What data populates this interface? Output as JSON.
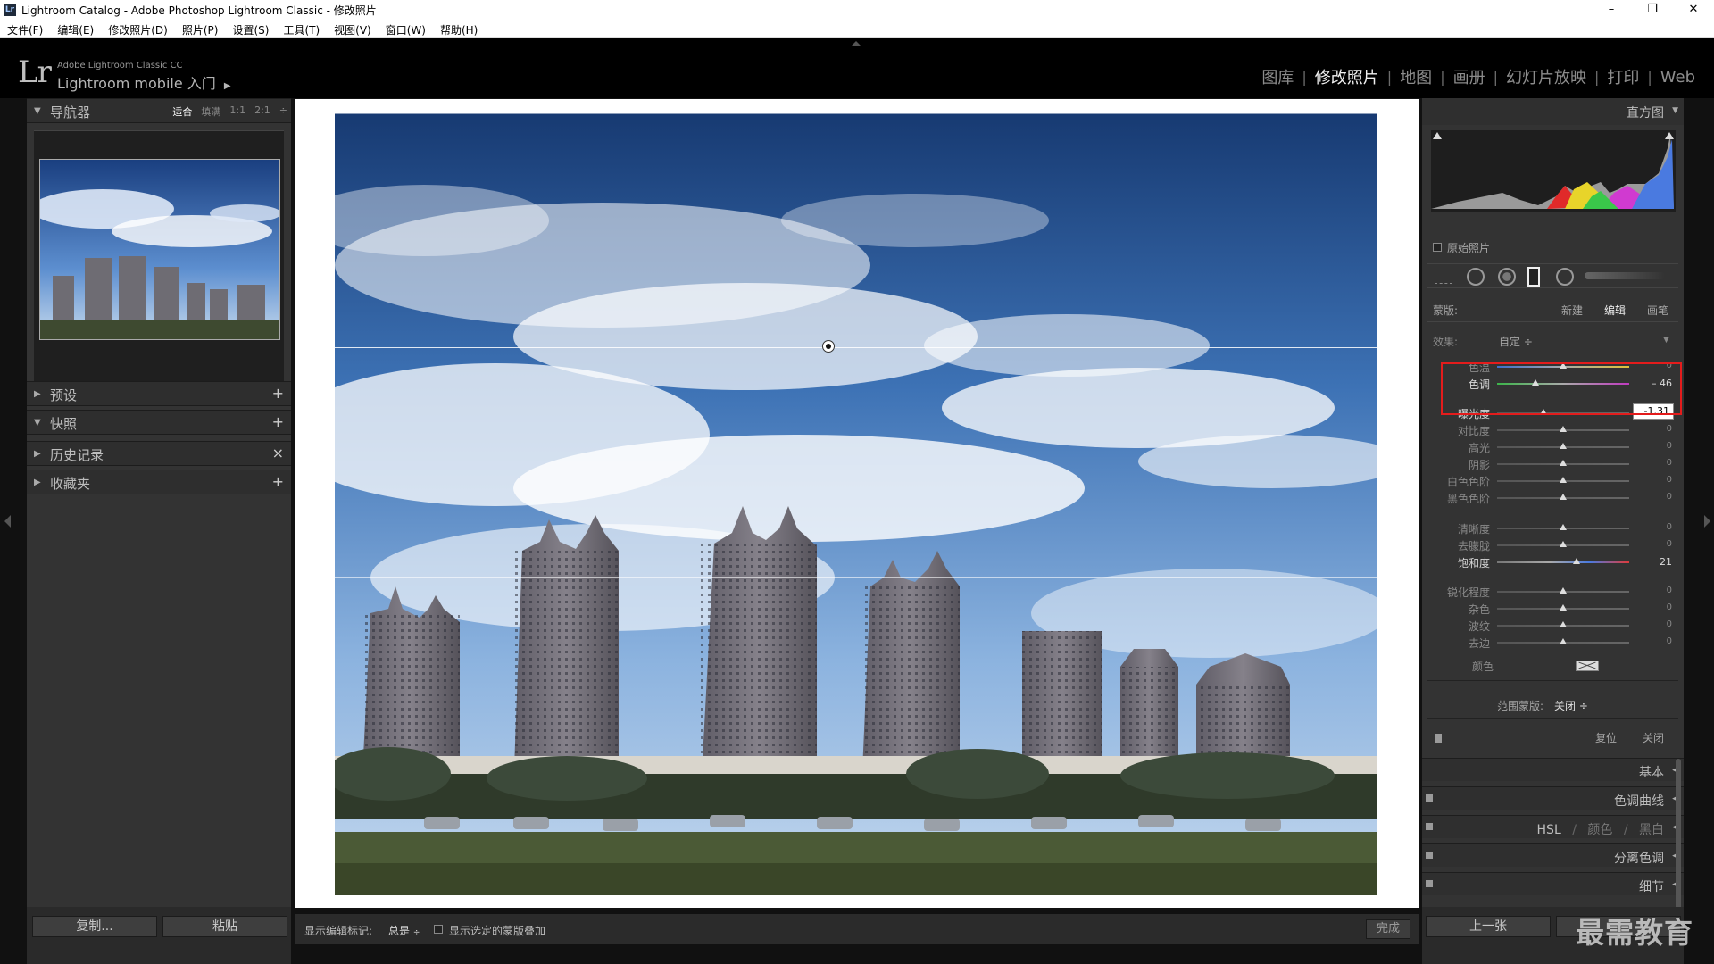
{
  "window": {
    "app_icon": "Lr",
    "title": "Lightroom Catalog - Adobe Photoshop Lightroom Classic - 修改照片",
    "minimize": "–",
    "maximize": "❐",
    "close": "✕"
  },
  "menu": [
    "文件(F)",
    "编辑(E)",
    "修改照片(D)",
    "照片(P)",
    "设置(S)",
    "工具(T)",
    "视图(V)",
    "窗口(W)",
    "帮助(H)"
  ],
  "identity": {
    "logo": "Lr",
    "product": "Adobe Lightroom Classic CC",
    "mobile": "Lightroom mobile 入门",
    "mobile_arrow": "▶"
  },
  "modules": [
    {
      "label": "图库",
      "active": false
    },
    {
      "label": "修改照片",
      "active": true
    },
    {
      "label": "地图",
      "active": false
    },
    {
      "label": "画册",
      "active": false
    },
    {
      "label": "幻灯片放映",
      "active": false
    },
    {
      "label": "打印",
      "active": false
    },
    {
      "label": "Web",
      "active": false
    }
  ],
  "module_separator": "|",
  "left_panel": {
    "navigator": {
      "label": "导航器",
      "zoom_fit": "适合",
      "zoom_fill": "填满",
      "zoom_1": "1:1",
      "zoom_2": "2:1",
      "zoom_more": "÷"
    },
    "presets": {
      "label": "预设",
      "action": "+"
    },
    "snapshots": {
      "label": "快照",
      "action": "+"
    },
    "history": {
      "label": "历史记录",
      "action": "×"
    },
    "collections": {
      "label": "收藏夹",
      "action": "+"
    },
    "copy_button": "复制...",
    "paste_button": "粘贴"
  },
  "toolbar": {
    "show_edit_pins_label": "显示编辑标记:",
    "show_edit_pins_value": "总是",
    "show_overlay_label": "显示选定的蒙版叠加",
    "done_button": "完成"
  },
  "right_panel": {
    "histogram": {
      "label": "直方图",
      "original_photo": "原始照片"
    },
    "mask": {
      "label": "蒙版:",
      "new": "新建",
      "edit": "编辑",
      "brush": "画笔"
    },
    "effect": {
      "label": "效果:",
      "value": "自定 ÷",
      "collapse": "▼"
    },
    "sliders": [
      {
        "label": "色温",
        "value": "0",
        "pos": 0.5,
        "track": "temp",
        "active": false
      },
      {
        "label": "色调",
        "value": "– 46",
        "pos": 0.29,
        "track": "tint",
        "active": true
      },
      {
        "label": "曝光度",
        "value": "-1.31",
        "pos": 0.35,
        "track": "gray",
        "active": true,
        "highlight": true
      },
      {
        "label": "对比度",
        "value": "0",
        "pos": 0.5,
        "track": "gray",
        "active": false
      },
      {
        "label": "高光",
        "value": "0",
        "pos": 0.5,
        "track": "gray",
        "active": false
      },
      {
        "label": "阴影",
        "value": "0",
        "pos": 0.5,
        "track": "gray",
        "active": false
      },
      {
        "label": "白色色阶",
        "value": "0",
        "pos": 0.5,
        "track": "gray",
        "active": false
      },
      {
        "label": "黑色色阶",
        "value": "0",
        "pos": 0.5,
        "track": "gray",
        "active": false
      },
      {
        "label": "清晰度",
        "value": "0",
        "pos": 0.5,
        "track": "gray",
        "active": false
      },
      {
        "label": "去朦胧",
        "value": "0",
        "pos": 0.5,
        "track": "gray",
        "active": false
      },
      {
        "label": "饱和度",
        "value": "21",
        "pos": 0.6,
        "track": "sat",
        "active": true
      },
      {
        "label": "锐化程度",
        "value": "0",
        "pos": 0.5,
        "track": "gray",
        "active": false
      },
      {
        "label": "杂色",
        "value": "0",
        "pos": 0.5,
        "track": "gray",
        "active": false
      },
      {
        "label": "波纹",
        "value": "0",
        "pos": 0.5,
        "track": "gray",
        "active": false
      },
      {
        "label": "去边",
        "value": "0",
        "pos": 0.5,
        "track": "gray",
        "active": false
      }
    ],
    "color_label": "颜色",
    "range_mask_label": "范围蒙版:",
    "range_mask_value": "关闭 ÷",
    "reset": "复位",
    "close": "关闭",
    "panels": {
      "basic": "基本",
      "tone_curve": "色调曲线",
      "hsl": "HSL",
      "hsl_color": "颜色",
      "hsl_bw": "黑白",
      "hsl_sep": "/",
      "split_toning": "分离色调",
      "detail": "细节"
    },
    "prev_button": "上一张"
  },
  "watermark": "最需教育",
  "icons": [
    "navigator-collapse-icon",
    "panel-expand-icon",
    "add-icon",
    "clear-icon",
    "crop-overlay-icon",
    "spot-removal-icon",
    "red-eye-icon",
    "graduated-filter-icon",
    "radial-filter-icon",
    "adjustment-brush-icon",
    "mask-pin-icon",
    "color-swatch-icon",
    "panel-toggle-icon"
  ]
}
